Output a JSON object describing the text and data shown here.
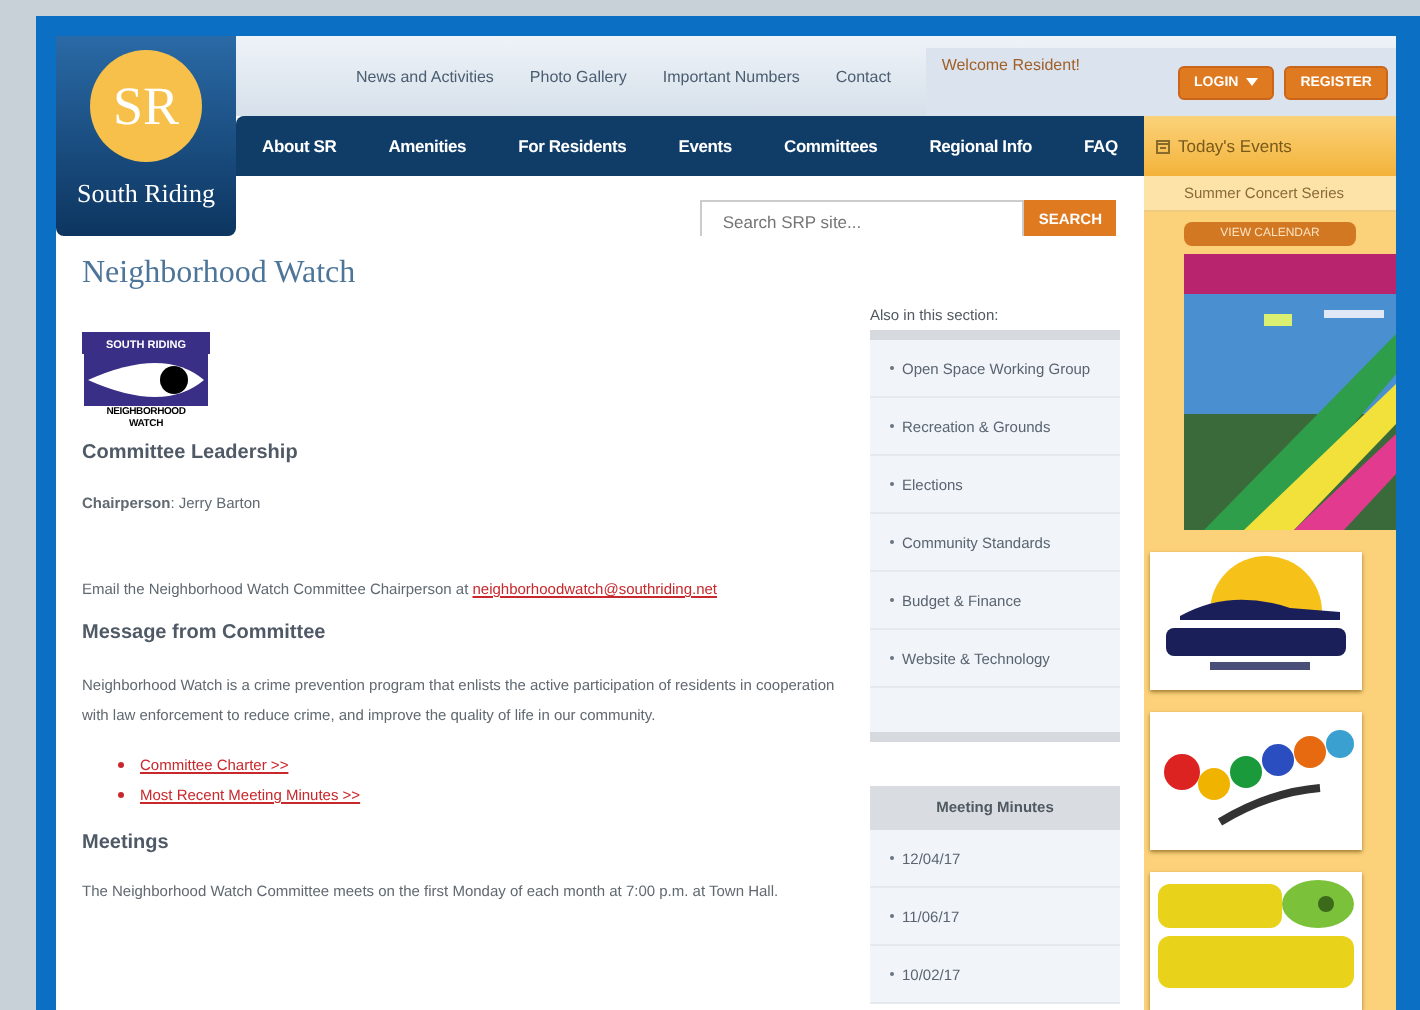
{
  "logo": {
    "initials": "SR",
    "name": "South Riding"
  },
  "top_links": [
    "News and Activities",
    "Photo Gallery",
    "Important Numbers",
    "Contact"
  ],
  "welcome": "Welcome Resident!",
  "login_button": "LOGIN",
  "register_button": "REGISTER",
  "nav": [
    "About SR",
    "Amenities",
    "For Residents",
    "Events",
    "Committees",
    "Regional Info",
    "FAQ"
  ],
  "search": {
    "placeholder": "Search SRP site...",
    "button": "SEARCH"
  },
  "page_title": "Neighborhood Watch",
  "badge": {
    "top": "SOUTH RIDING",
    "bottom": [
      "NEIGHBORHOOD",
      "WATCH"
    ]
  },
  "leadership": {
    "heading": "Committee Leadership",
    "chair": "**Chairperson**: Jerry Barton"
  },
  "email": {
    "text": "Email the Neighborhood Watch Committee Chairperson at ",
    "link": "neighborhoodwatch@southriding.net"
  },
  "message": {
    "heading": "Message from Committee",
    "text": "Neighborhood Watch is a crime prevention program that enlists the active participation of residents in cooperation with law enforcement to reduce crime, and improve the quality of life in our community.",
    "links": [
      "Committee Charter >>",
      "Most Recent Meeting Minutes >>"
    ]
  },
  "meetings": {
    "heading": "Meetings",
    "text": "The Neighborhood Watch Committee meets on the first Monday of each month at 7:00 p.m. at Town Hall."
  },
  "section": {
    "heading": "Also in this section:",
    "items": [
      "Open Space Working Group",
      "Recreation & Grounds",
      "Elections",
      "Community Standards",
      "Budget & Finance",
      "Website & Technology"
    ]
  },
  "minutes": {
    "heading": "Meeting Minutes",
    "items": [
      "12/04/17",
      "11/06/17",
      "10/02/17"
    ]
  },
  "events": {
    "heading": "Today's Events",
    "items": [
      "Summer Concert Series"
    ],
    "button": "VIEW CALENDAR"
  }
}
